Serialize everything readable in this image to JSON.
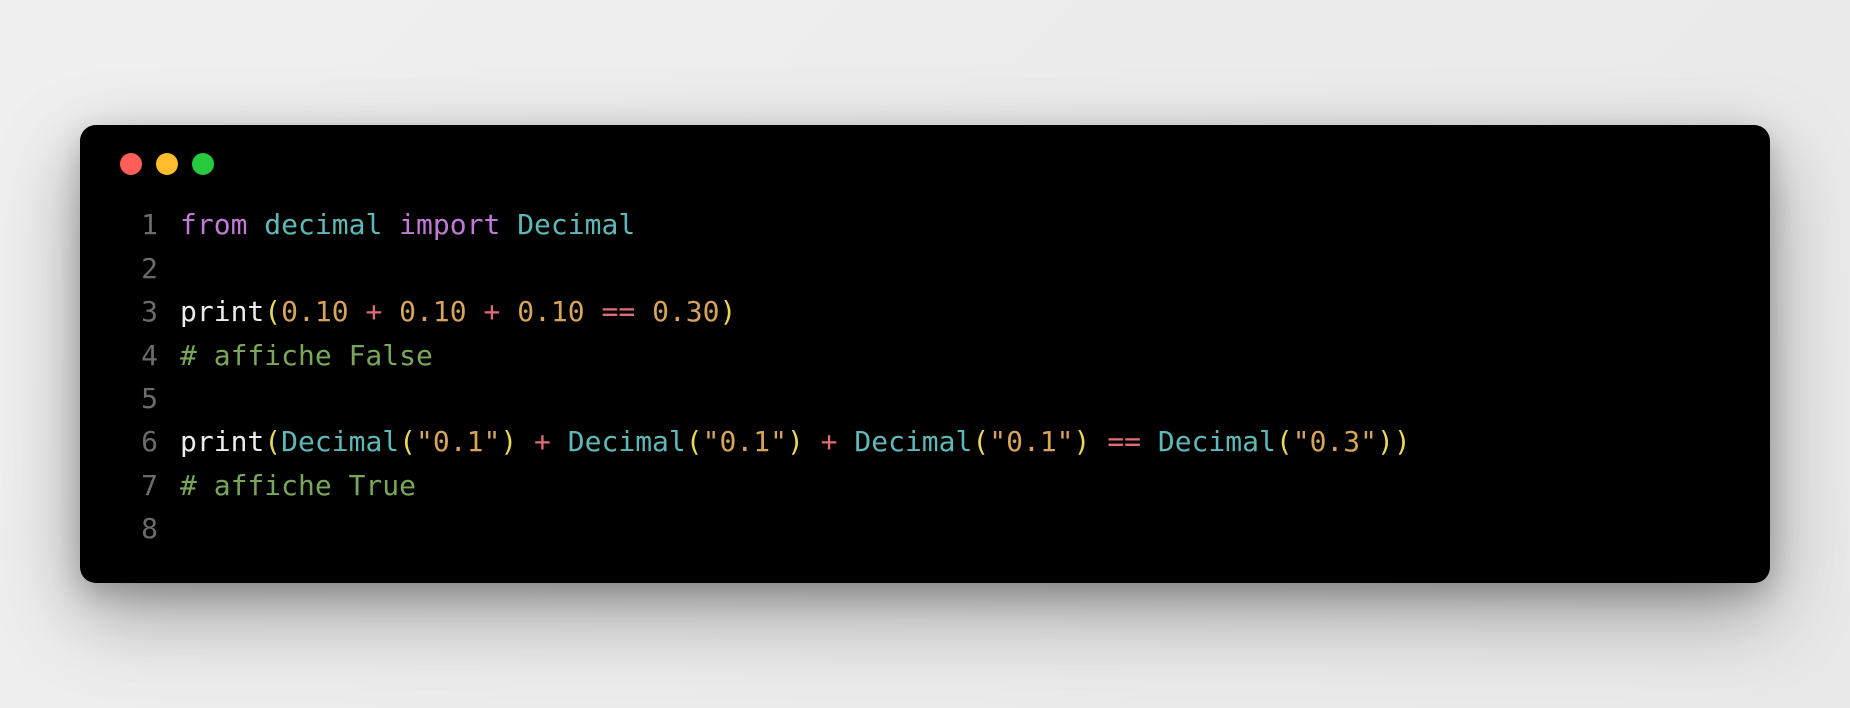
{
  "window": {
    "traffic_lights": [
      "close",
      "minimize",
      "zoom"
    ]
  },
  "code": {
    "lines": [
      {
        "n": "1",
        "tokens": [
          {
            "t": "from",
            "c": "kw"
          },
          {
            "t": " ",
            "c": ""
          },
          {
            "t": "decimal",
            "c": "mod"
          },
          {
            "t": " ",
            "c": ""
          },
          {
            "t": "import",
            "c": "kw"
          },
          {
            "t": " ",
            "c": ""
          },
          {
            "t": "Decimal",
            "c": "cls"
          }
        ]
      },
      {
        "n": "2",
        "tokens": []
      },
      {
        "n": "3",
        "tokens": [
          {
            "t": "print",
            "c": "fn"
          },
          {
            "t": "(",
            "c": "punct"
          },
          {
            "t": "0.10",
            "c": "num"
          },
          {
            "t": " ",
            "c": ""
          },
          {
            "t": "+",
            "c": "op"
          },
          {
            "t": " ",
            "c": ""
          },
          {
            "t": "0.10",
            "c": "num"
          },
          {
            "t": " ",
            "c": ""
          },
          {
            "t": "+",
            "c": "op"
          },
          {
            "t": " ",
            "c": ""
          },
          {
            "t": "0.10",
            "c": "num"
          },
          {
            "t": " ",
            "c": ""
          },
          {
            "t": "==",
            "c": "op"
          },
          {
            "t": " ",
            "c": ""
          },
          {
            "t": "0.30",
            "c": "num"
          },
          {
            "t": ")",
            "c": "punct"
          }
        ]
      },
      {
        "n": "4",
        "tokens": [
          {
            "t": "# affiche False",
            "c": "cmt"
          }
        ]
      },
      {
        "n": "5",
        "tokens": []
      },
      {
        "n": "6",
        "tokens": [
          {
            "t": "print",
            "c": "fn"
          },
          {
            "t": "(",
            "c": "punct"
          },
          {
            "t": "Decimal",
            "c": "cls"
          },
          {
            "t": "(",
            "c": "punct"
          },
          {
            "t": "\"0.1\"",
            "c": "str"
          },
          {
            "t": ")",
            "c": "punct"
          },
          {
            "t": " ",
            "c": ""
          },
          {
            "t": "+",
            "c": "op"
          },
          {
            "t": " ",
            "c": ""
          },
          {
            "t": "Decimal",
            "c": "cls"
          },
          {
            "t": "(",
            "c": "punct"
          },
          {
            "t": "\"0.1\"",
            "c": "str"
          },
          {
            "t": ")",
            "c": "punct"
          },
          {
            "t": " ",
            "c": ""
          },
          {
            "t": "+",
            "c": "op"
          },
          {
            "t": " ",
            "c": ""
          },
          {
            "t": "Decimal",
            "c": "cls"
          },
          {
            "t": "(",
            "c": "punct"
          },
          {
            "t": "\"0.1\"",
            "c": "str"
          },
          {
            "t": ")",
            "c": "punct"
          },
          {
            "t": " ",
            "c": ""
          },
          {
            "t": "==",
            "c": "op"
          },
          {
            "t": " ",
            "c": ""
          },
          {
            "t": "Decimal",
            "c": "cls"
          },
          {
            "t": "(",
            "c": "punct"
          },
          {
            "t": "\"0.3\"",
            "c": "str"
          },
          {
            "t": ")",
            "c": "punct"
          },
          {
            "t": ")",
            "c": "punct"
          }
        ]
      },
      {
        "n": "7",
        "tokens": [
          {
            "t": "# affiche True",
            "c": "cmt"
          }
        ]
      },
      {
        "n": "8",
        "tokens": []
      }
    ]
  }
}
